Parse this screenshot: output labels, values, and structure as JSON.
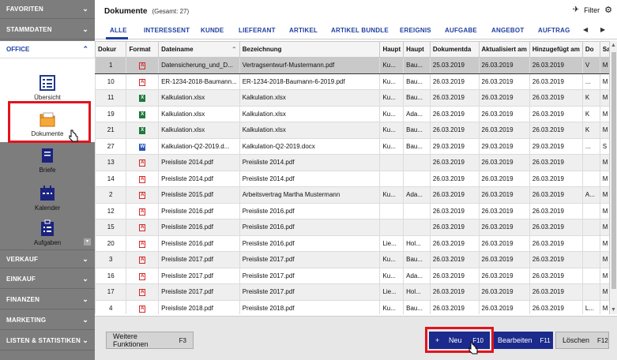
{
  "sidebar": {
    "favoriten": "FAVORITEN",
    "stammdaten": "STAMMDATEN",
    "office": "OFFICE",
    "office_items": [
      "Übersicht",
      "Dokumente"
    ],
    "group_items": [
      "Briefe",
      "Kalender",
      "Aufgaben"
    ],
    "lower_sections": [
      "VERKAUF",
      "EINKAUF",
      "FINANZEN",
      "MARKETING",
      "LISTEN & STATISTIKEN"
    ]
  },
  "header": {
    "title": "Dokumente",
    "count": "(Gesamt: 27)",
    "filter": "Filter"
  },
  "tabs": [
    "ALLE",
    "INTERESSENT",
    "KUNDE",
    "LIEFERANT",
    "ARTIKEL",
    "ARTIKEL BUNDLE",
    "EREIGNIS",
    "AUFGABE",
    "ANGEBOT",
    "AUFTRAG"
  ],
  "columns": [
    "Dokur",
    "Format",
    "Dateiname",
    "Bezeichnung",
    "Haupt",
    "Haupt",
    "Dokumentda",
    "Aktualisiert am",
    "Hinzugefügt am",
    "Do",
    "Sac"
  ],
  "rows": [
    {
      "n": "1",
      "f": "pdf",
      "file": "Datensicherung_und_D...",
      "desc": "Vertragsentwurf-Mustermann.pdf",
      "h1": "Ku...",
      "h2": "Bau...",
      "dd": "25.03.2019",
      "upd": "26.03.2019",
      "add": "26.03.2019",
      "do": "V",
      "sac": "M"
    },
    {
      "n": "10",
      "f": "pdf",
      "file": "ER-1234-2018-Baumann...",
      "desc": "ER-1234-2018-Baumann-6-2019.pdf",
      "h1": "Ku...",
      "h2": "Bau...",
      "dd": "26.03.2019",
      "upd": "26.03.2019",
      "add": "26.03.2019",
      "do": "...",
      "sac": "M"
    },
    {
      "n": "11",
      "f": "xls",
      "file": "Kalkulation.xlsx",
      "desc": "Kalkulation.xlsx",
      "h1": "Ku...",
      "h2": "Bau...",
      "dd": "26.03.2019",
      "upd": "26.03.2019",
      "add": "26.03.2019",
      "do": "K",
      "sac": "M"
    },
    {
      "n": "19",
      "f": "xls",
      "file": "Kalkulation.xlsx",
      "desc": "Kalkulation.xlsx",
      "h1": "Ku...",
      "h2": "Ada...",
      "dd": "26.03.2019",
      "upd": "26.03.2019",
      "add": "26.03.2019",
      "do": "K",
      "sac": "M"
    },
    {
      "n": "21",
      "f": "xls",
      "file": "Kalkulation.xlsx",
      "desc": "Kalkulation.xlsx",
      "h1": "Ku...",
      "h2": "Bau...",
      "dd": "26.03.2019",
      "upd": "26.03.2019",
      "add": "26.03.2019",
      "do": "K",
      "sac": "M"
    },
    {
      "n": "27",
      "f": "doc",
      "file": "Kalkulation-Q2-2019.d...",
      "desc": "Kalkulation-Q2-2019.docx",
      "h1": "Ku...",
      "h2": "Bau...",
      "dd": "29.03.2019",
      "upd": "29.03.2019",
      "add": "29.03.2019",
      "do": "...",
      "sac": "S"
    },
    {
      "n": "13",
      "f": "pdf",
      "file": "Preisliste 2014.pdf",
      "desc": "Preisliste 2014.pdf",
      "h1": "",
      "h2": "",
      "dd": "26.03.2019",
      "upd": "26.03.2019",
      "add": "26.03.2019",
      "do": "",
      "sac": "M"
    },
    {
      "n": "14",
      "f": "pdf",
      "file": "Preisliste 2014.pdf",
      "desc": "Preisliste 2014.pdf",
      "h1": "",
      "h2": "",
      "dd": "26.03.2019",
      "upd": "26.03.2019",
      "add": "26.03.2019",
      "do": "",
      "sac": "M"
    },
    {
      "n": "2",
      "f": "pdf",
      "file": "Preisliste 2015.pdf",
      "desc": "Arbeitsvertrag Martha Mustermann",
      "h1": "Ku...",
      "h2": "Ada...",
      "dd": "26.03.2019",
      "upd": "26.03.2019",
      "add": "26.03.2019",
      "do": "A...",
      "sac": "M"
    },
    {
      "n": "12",
      "f": "pdf",
      "file": "Preisliste 2016.pdf",
      "desc": "Preisliste 2016.pdf",
      "h1": "",
      "h2": "",
      "dd": "26.03.2019",
      "upd": "26.03.2019",
      "add": "26.03.2019",
      "do": "",
      "sac": "M"
    },
    {
      "n": "15",
      "f": "pdf",
      "file": "Preisliste 2016.pdf",
      "desc": "Preisliste 2016.pdf",
      "h1": "",
      "h2": "",
      "dd": "26.03.2019",
      "upd": "26.03.2019",
      "add": "26.03.2019",
      "do": "",
      "sac": "M"
    },
    {
      "n": "20",
      "f": "pdf",
      "file": "Preisliste 2016.pdf",
      "desc": "Preisliste 2016.pdf",
      "h1": "Lie...",
      "h2": "Hol...",
      "dd": "26.03.2019",
      "upd": "26.03.2019",
      "add": "26.03.2019",
      "do": "",
      "sac": "M"
    },
    {
      "n": "3",
      "f": "pdf",
      "file": "Preisliste 2017.pdf",
      "desc": "Preisliste 2017.pdf",
      "h1": "Ku...",
      "h2": "Bau...",
      "dd": "26.03.2019",
      "upd": "26.03.2019",
      "add": "26.03.2019",
      "do": "",
      "sac": "M"
    },
    {
      "n": "16",
      "f": "pdf",
      "file": "Preisliste 2017.pdf",
      "desc": "Preisliste 2017.pdf",
      "h1": "Ku...",
      "h2": "Ada...",
      "dd": "26.03.2019",
      "upd": "26.03.2019",
      "add": "26.03.2019",
      "do": "",
      "sac": "M"
    },
    {
      "n": "17",
      "f": "pdf",
      "file": "Preisliste 2017.pdf",
      "desc": "Preisliste 2017.pdf",
      "h1": "Lie...",
      "h2": "Hol...",
      "dd": "26.03.2019",
      "upd": "26.03.2019",
      "add": "26.03.2019",
      "do": "",
      "sac": "M"
    },
    {
      "n": "4",
      "f": "pdf",
      "file": "Preisliste 2018.pdf",
      "desc": "Preisliste 2018.pdf",
      "h1": "Ku...",
      "h2": "Bau...",
      "dd": "26.03.2019",
      "upd": "26.03.2019",
      "add": "26.03.2019",
      "do": "L...",
      "sac": "M"
    }
  ],
  "buttons": {
    "weitere": "Weitere Funktionen",
    "weitere_key": "F3",
    "neu_plus": "+",
    "neu": "Neu",
    "neu_key": "F10",
    "bearbeiten": "Bearbeiten",
    "bearbeiten_key": "F11",
    "loeschen": "Löschen",
    "loeschen_key": "F12"
  },
  "colors": {
    "accent": "#1b2a8c",
    "highlight": "#e1141c",
    "sidebar": "#7d7d7d"
  }
}
